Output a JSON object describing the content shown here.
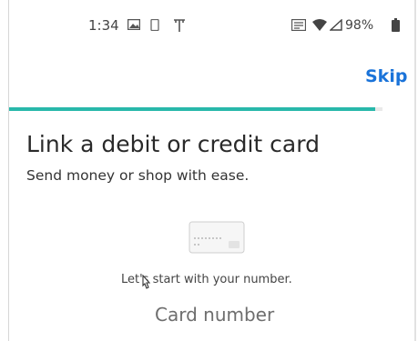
{
  "status_bar": {
    "time": "1:34",
    "battery_percent": "98%",
    "icons": [
      "notification-image-icon",
      "notification-phone-icon",
      "notification-antenna-icon",
      "cast-icon",
      "wifi-icon",
      "signal-icon",
      "battery-icon"
    ]
  },
  "header": {
    "skip_label": "Skip"
  },
  "progress": {
    "fraction": 0.98,
    "color": "#28b8aa"
  },
  "main": {
    "title": "Link a debit or credit card",
    "subtitle": "Send money or shop with ease.",
    "illustration_icon": "credit-card-icon",
    "prompt": "Let's start with your number.",
    "card_number_placeholder": "Card number"
  },
  "colors": {
    "accent": "#1a73d9",
    "progress": "#28b8aa"
  }
}
